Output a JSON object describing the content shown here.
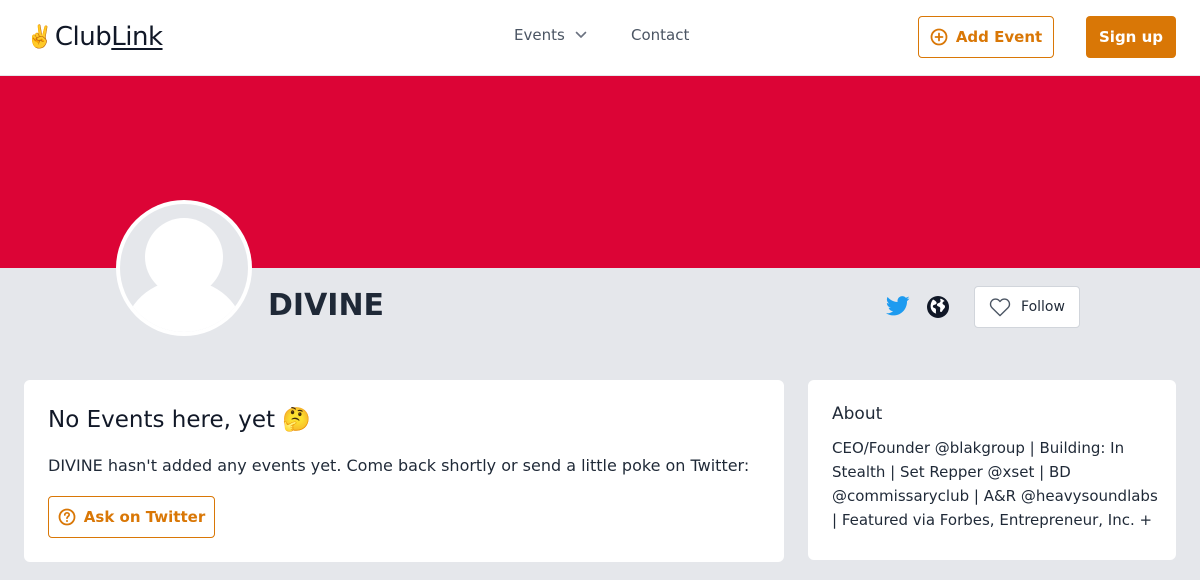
{
  "header": {
    "logo_emoji": "✌️",
    "logo_club": "Club",
    "logo_link": "Link",
    "nav_events": "Events",
    "nav_contact": "Contact",
    "add_event": "Add Event",
    "sign_up": "Sign up"
  },
  "profile": {
    "name": "DIVINE",
    "follow": "Follow"
  },
  "events_card": {
    "title": "No Events here, yet 🤔",
    "description": "DIVINE hasn't added any events yet. Come back shortly or send a little poke on Twitter:",
    "ask_button": "Ask on Twitter"
  },
  "about_card": {
    "title": "About",
    "text": "CEO/Founder @blakgroup | Building: In Stealth | Set Repper @xset | BD @commissaryclub | A&R @heavysoundlabs | Featured via Forbes, Entrepreneur, Inc. +"
  },
  "colors": {
    "accent": "#d97706",
    "banner": "#dc0436",
    "twitter": "#1d9bf0",
    "background": "#e5e7eb"
  },
  "icons": [
    "chevron-down-icon",
    "plus-circle-icon",
    "twitter-icon",
    "globe-icon",
    "heart-icon",
    "question-circle-icon"
  ]
}
